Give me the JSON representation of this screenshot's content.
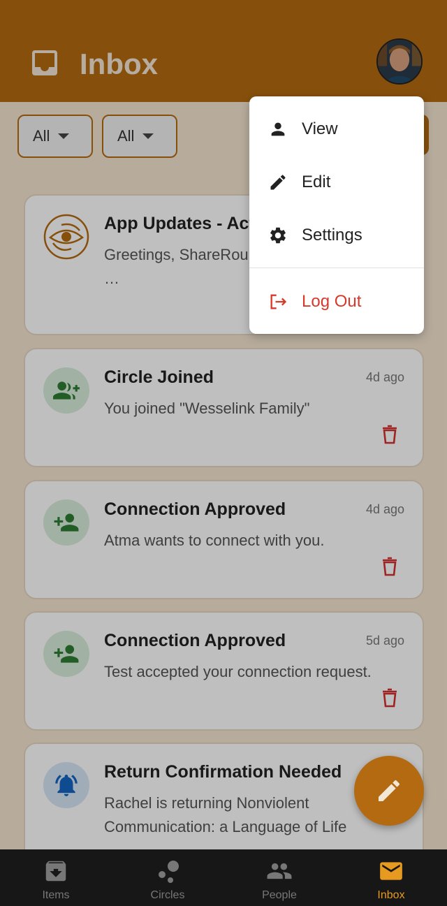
{
  "header": {
    "title": "Inbox",
    "accent_color": "#b36a11"
  },
  "filters": {
    "first": "All",
    "second": "All"
  },
  "notifications": [
    {
      "title": "App Updates - Act",
      "body": "Greetings, ShareRou",
      "body_more": "…",
      "time": "",
      "icon": "sharing-hands-logo"
    },
    {
      "title": "Circle Joined",
      "body": "You joined \"Wesselink Family\"",
      "time": "4d ago",
      "icon": "group-add-icon"
    },
    {
      "title": "Connection Approved",
      "body": "Atma wants to connect with you.",
      "time": "4d ago",
      "icon": "person-add-icon"
    },
    {
      "title": "Connection Approved",
      "body": "Test accepted your connection request.",
      "time": "5d ago",
      "icon": "person-add-icon"
    },
    {
      "title": "Return Confirmation Needed",
      "body": "Rachel is returning Nonviolent Communication: a Language of Life",
      "time": "",
      "icon": "bell-icon"
    }
  ],
  "menu": {
    "view": "View",
    "edit": "Edit",
    "settings": "Settings",
    "logout": "Log Out",
    "logout_color": "#d9382c"
  },
  "nav": [
    {
      "label": "Items",
      "icon": "archive-box-icon"
    },
    {
      "label": "Circles",
      "icon": "circles-icon"
    },
    {
      "label": "People",
      "icon": "people-icon"
    },
    {
      "label": "Inbox",
      "icon": "mail-icon",
      "active": true
    }
  ]
}
